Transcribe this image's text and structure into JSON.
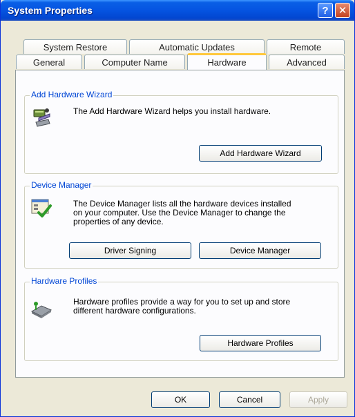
{
  "window": {
    "title": "System Properties",
    "help_glyph": "?",
    "close_glyph": "✕"
  },
  "tabs_row1": [
    {
      "label": "System Restore"
    },
    {
      "label": "Automatic Updates"
    },
    {
      "label": "Remote"
    }
  ],
  "tabs_row2": [
    {
      "label": "General"
    },
    {
      "label": "Computer Name"
    },
    {
      "label": "Hardware",
      "selected": true
    },
    {
      "label": "Advanced"
    }
  ],
  "add_hardware": {
    "title": "Add Hardware Wizard",
    "description": "The Add Hardware Wizard helps you install hardware.",
    "button": "Add Hardware Wizard"
  },
  "device_manager": {
    "title": "Device Manager",
    "description_lines": [
      "The Device Manager lists all the hardware devices installed",
      "on your computer. Use the Device Manager to change the",
      "properties of any device."
    ],
    "driver_button": "Driver Signing",
    "device_button": "Device Manager"
  },
  "hardware_profiles": {
    "title": "Hardware Profiles",
    "description_lines": [
      "Hardware profiles provide a way for you to set up and store",
      "different hardware configurations."
    ],
    "button": "Hardware Profiles"
  },
  "footer": {
    "ok": "OK",
    "cancel": "Cancel",
    "apply": "Apply"
  },
  "colors": {
    "title_bar": "#0554e1",
    "group_title": "#0046d5",
    "tab_highlight": "#ffc83c"
  },
  "icons": {
    "add_hardware": "hardware-wizard-icon",
    "device_manager": "device-manager-icon",
    "hardware_profiles": "hardware-profiles-icon"
  }
}
